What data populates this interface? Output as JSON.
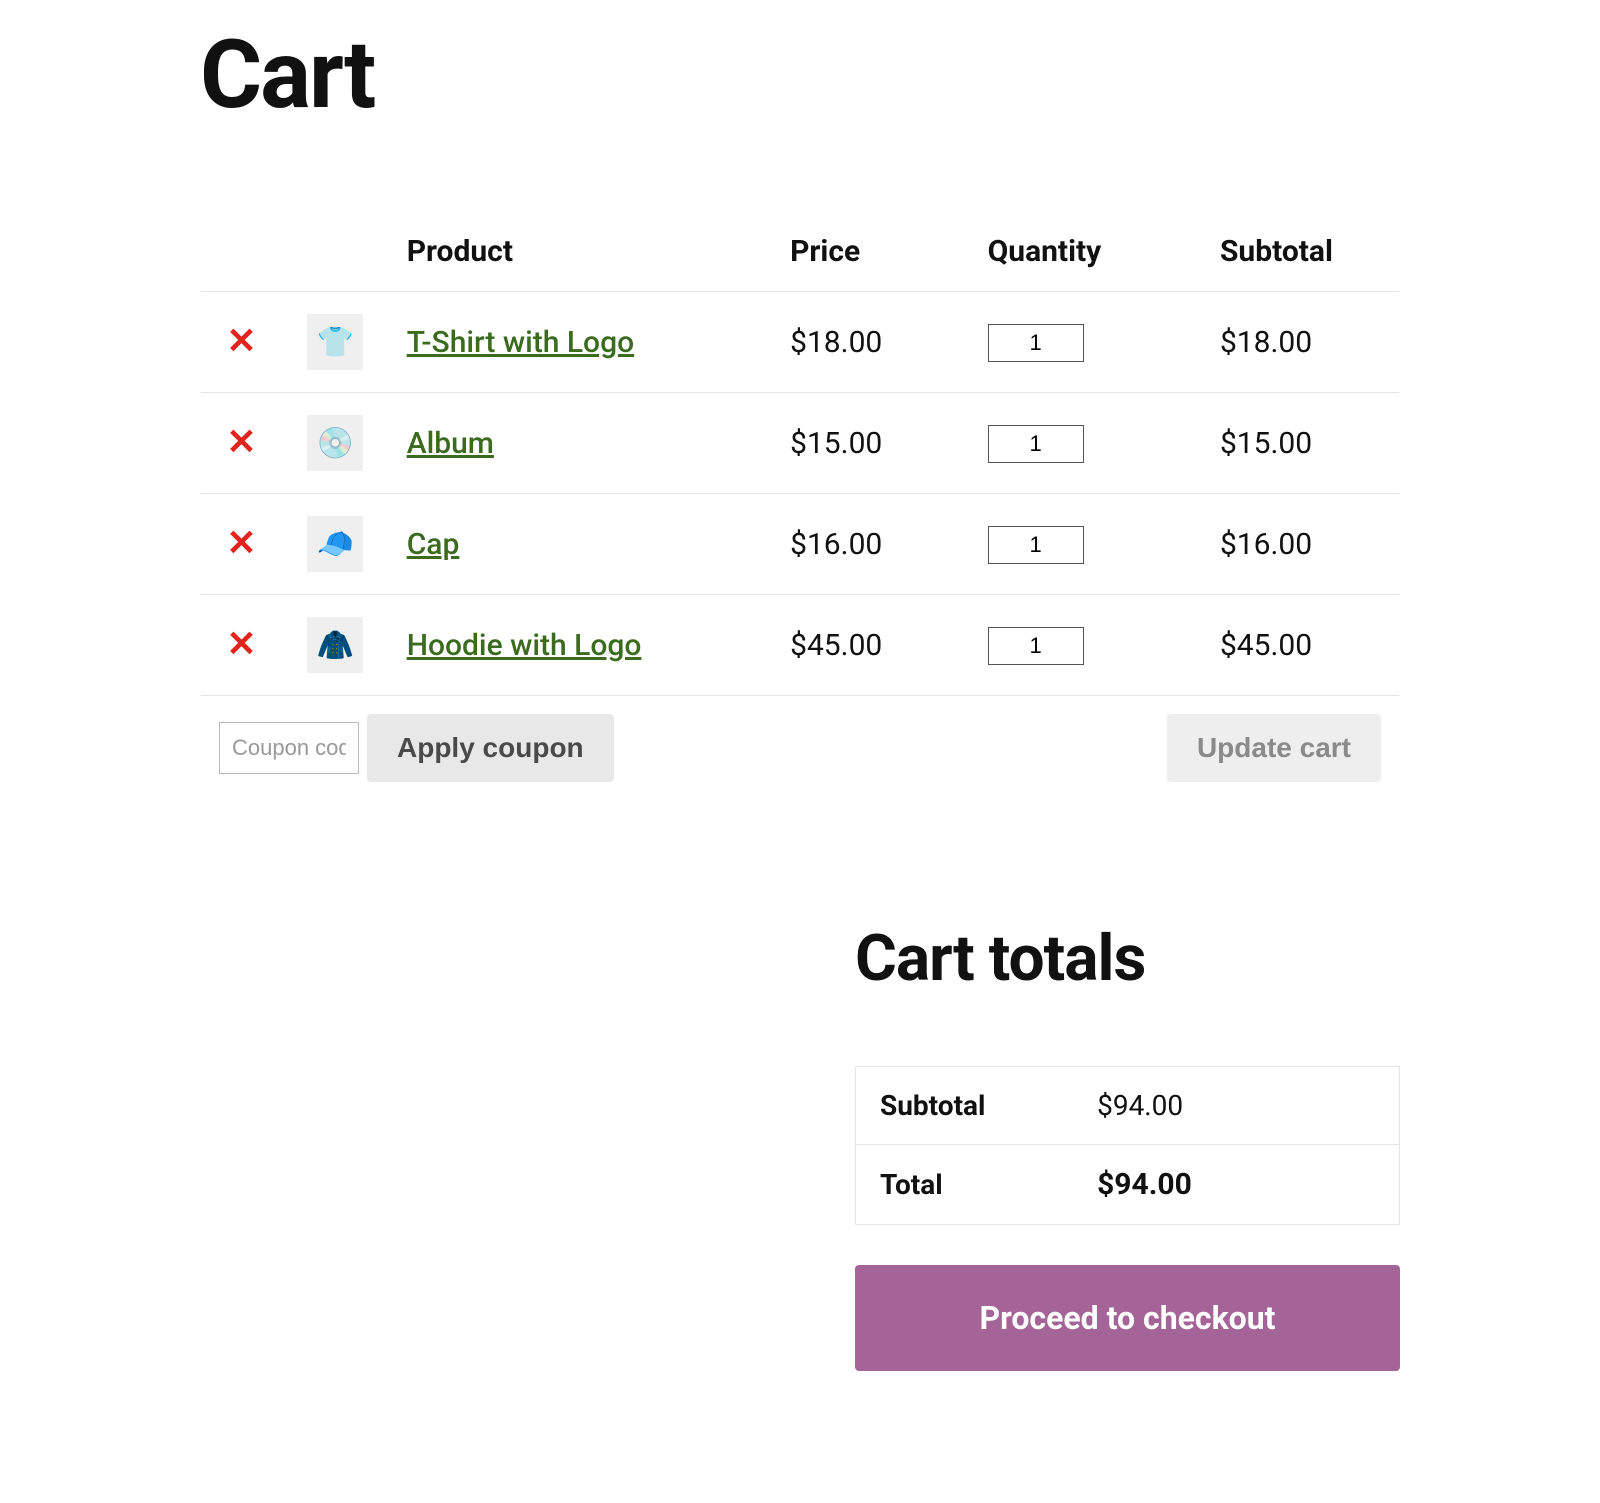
{
  "page_title": "Cart",
  "table": {
    "headers": {
      "product": "Product",
      "price": "Price",
      "quantity": "Quantity",
      "subtotal": "Subtotal"
    },
    "items": [
      {
        "icon": "👕",
        "name": "T-Shirt with Logo",
        "price": "$18.00",
        "qty": "1",
        "subtotal": "$18.00"
      },
      {
        "icon": "💿",
        "name": "Album",
        "price": "$15.00",
        "qty": "1",
        "subtotal": "$15.00"
      },
      {
        "icon": "🧢",
        "name": "Cap",
        "price": "$16.00",
        "qty": "1",
        "subtotal": "$16.00"
      },
      {
        "icon": "🧥",
        "name": "Hoodie with Logo",
        "price": "$45.00",
        "qty": "1",
        "subtotal": "$45.00"
      }
    ],
    "coupon_placeholder": "Coupon code",
    "apply_coupon_label": "Apply coupon",
    "update_cart_label": "Update cart"
  },
  "totals": {
    "title": "Cart totals",
    "subtotal_label": "Subtotal",
    "subtotal_value": "$94.00",
    "total_label": "Total",
    "total_value": "$94.00",
    "checkout_label": "Proceed to checkout"
  },
  "remove_symbol": "✕"
}
